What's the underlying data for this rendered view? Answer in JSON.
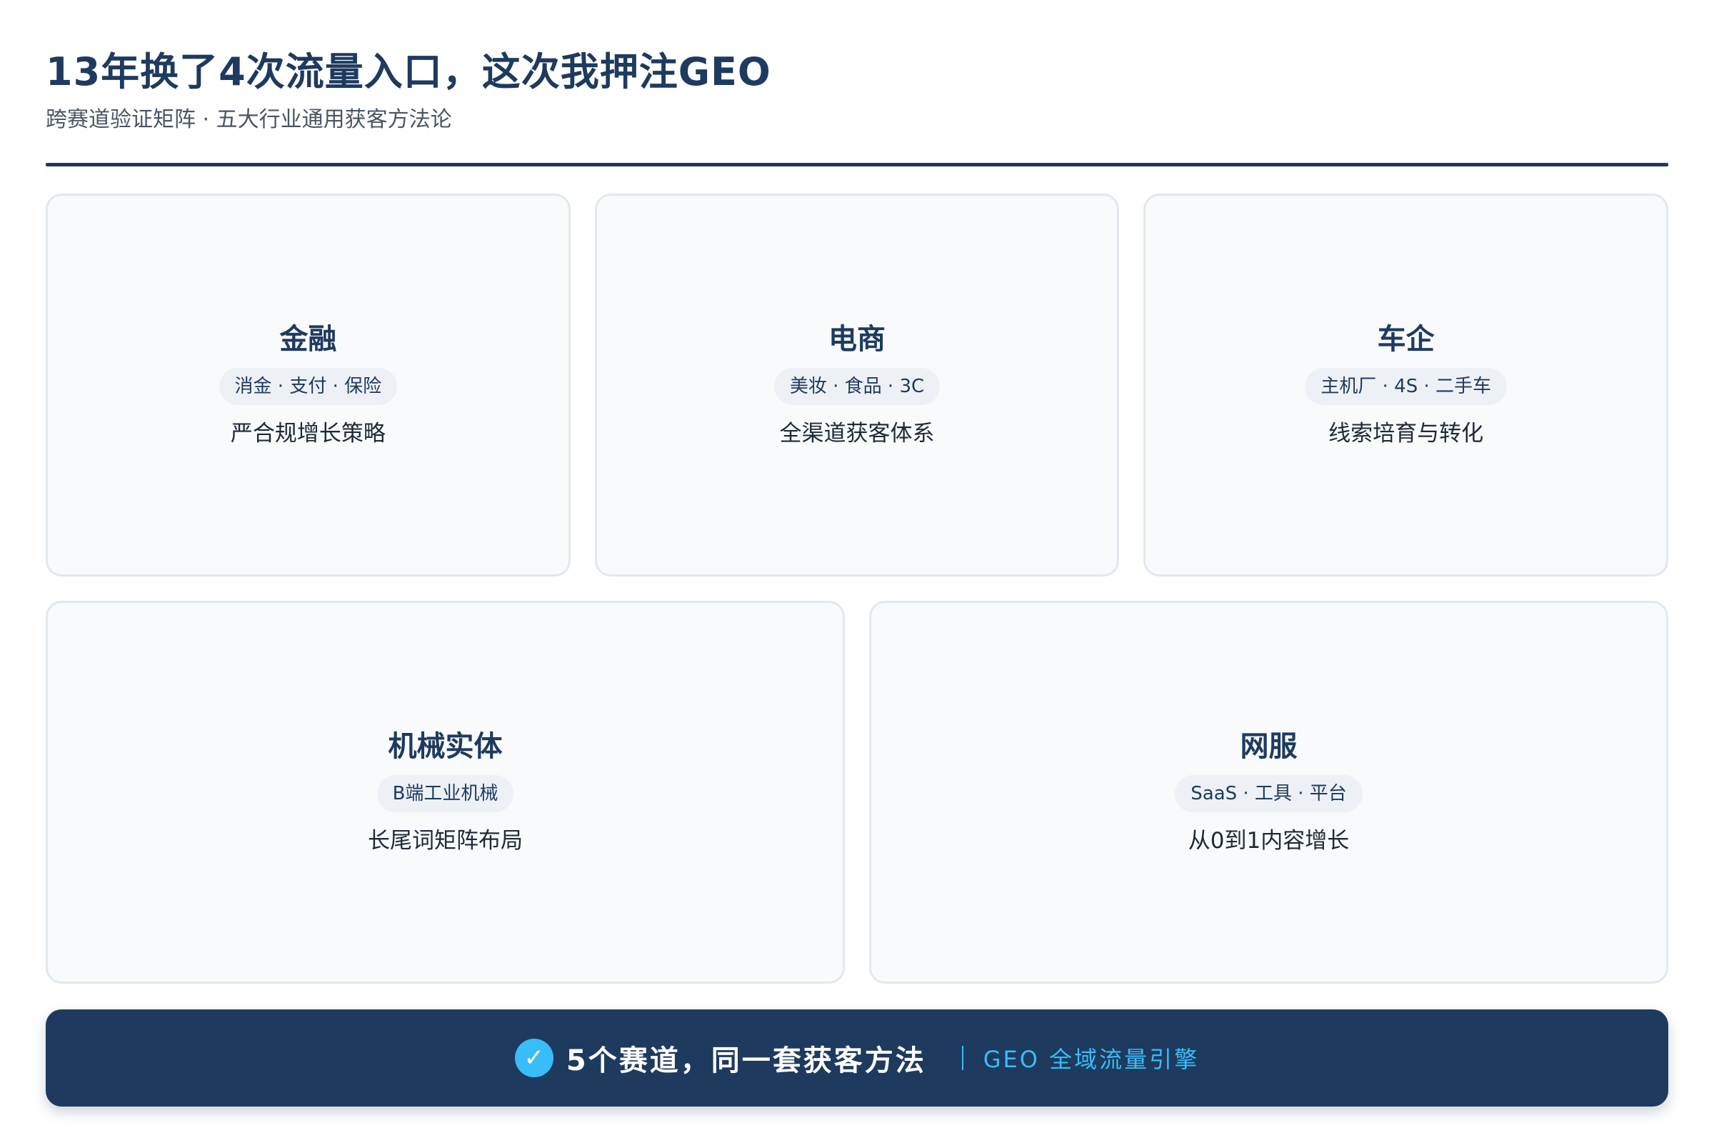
{
  "header": {
    "title": "13年换了4次流量入口，这次我押注GEO",
    "subtitle": "跨赛道验证矩阵 · 五大行业通用获客方法论"
  },
  "cards": [
    {
      "title": "金融",
      "tag": "消金 · 支付 · 保险",
      "desc": "严合规增长策略"
    },
    {
      "title": "电商",
      "tag": "美妆 · 食品 · 3C",
      "desc": "全渠道获客体系"
    },
    {
      "title": "车企",
      "tag": "主机厂 · 4S · 二手车",
      "desc": "线索培育与转化"
    },
    {
      "title": "机械实体",
      "tag": "B端工业机械",
      "desc": "长尾词矩阵布局"
    },
    {
      "title": "网服",
      "tag": "SaaS · 工具 · 平台",
      "desc": "从0到1内容增长"
    }
  ],
  "banner": {
    "check_glyph": "✓",
    "main": "5个赛道，同一套获客方法",
    "sub": "GEO 全域流量引擎"
  },
  "colors": {
    "primary": "#1e3a5f",
    "accent": "#38bdf8",
    "card_bg": "#f8fafc",
    "card_border": "#e2e8f0"
  }
}
